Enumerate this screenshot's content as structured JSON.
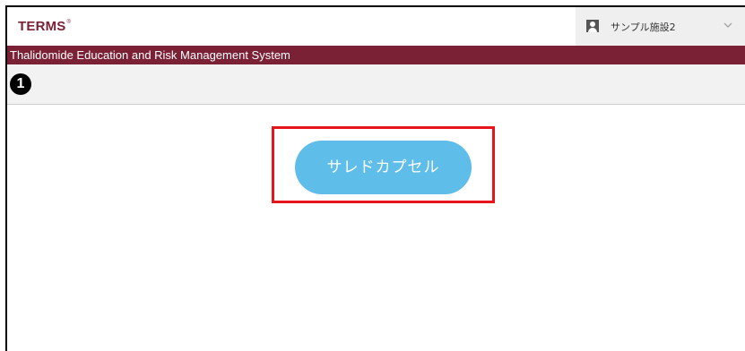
{
  "header": {
    "logo_text": "TERMS",
    "logo_mark": "®",
    "user": {
      "icon": "user-icon",
      "name": "サンプル施設2",
      "dropdown_icon": "chevron-down-icon"
    }
  },
  "banner": {
    "system_name": "Thalidomide Education and Risk Management System"
  },
  "toolbar": {
    "step_marker": "1"
  },
  "main": {
    "product_button_label": "サレドカプセル"
  },
  "colors": {
    "brand": "#7a2136",
    "button": "#5fbdea",
    "highlight": "#e8141c",
    "toolbar_bg": "#f2f2f2",
    "user_area_bg": "#efefef"
  }
}
